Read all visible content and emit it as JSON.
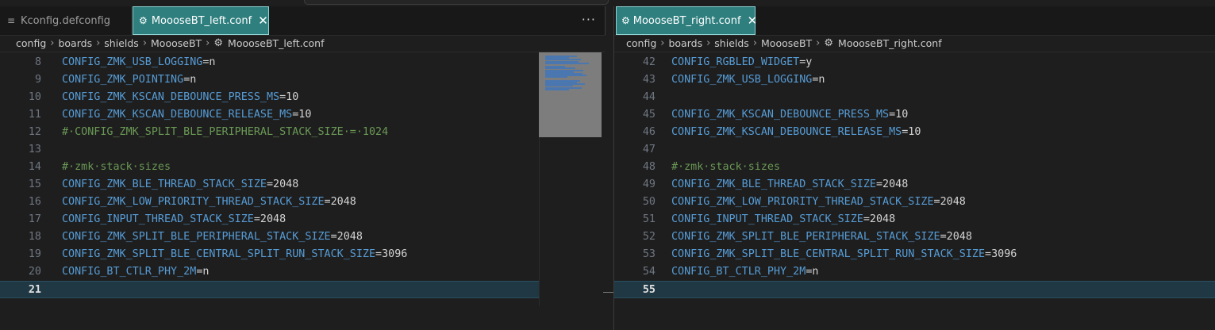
{
  "left": {
    "tabs": [
      {
        "label": "Kconfig.defconfig",
        "icon": "list-icon",
        "active": false
      },
      {
        "label": "MoooseBT_left.conf",
        "icon": "gear-icon",
        "active": true
      }
    ],
    "more_label": "···",
    "breadcrumb": [
      "config",
      "boards",
      "shields",
      "MoooseBT",
      "MoooseBT_left.conf"
    ],
    "current_line": "21",
    "lines": [
      {
        "n": "8",
        "key": "CONFIG_ZMK_USB_LOGGING",
        "val": "=n"
      },
      {
        "n": "9",
        "key": "CONFIG_ZMK_POINTING",
        "val": "=n"
      },
      {
        "n": "10",
        "key": "CONFIG_ZMK_KSCAN_DEBOUNCE_PRESS_MS",
        "val": "=10"
      },
      {
        "n": "11",
        "key": "CONFIG_ZMK_KSCAN_DEBOUNCE_RELEASE_MS",
        "val": "=10"
      },
      {
        "n": "12",
        "comment": "#·CONFIG_ZMK_SPLIT_BLE_PERIPHERAL_STACK_SIZE·=·1024"
      },
      {
        "n": "13"
      },
      {
        "n": "14",
        "comment": "#·zmk·stack·sizes"
      },
      {
        "n": "15",
        "key": "CONFIG_ZMK_BLE_THREAD_STACK_SIZE",
        "val": "=2048"
      },
      {
        "n": "16",
        "key": "CONFIG_ZMK_LOW_PRIORITY_THREAD_STACK_SIZE",
        "val": "=2048"
      },
      {
        "n": "17",
        "key": "CONFIG_INPUT_THREAD_STACK_SIZE",
        "val": "=2048"
      },
      {
        "n": "18",
        "key": "CONFIG_ZMK_SPLIT_BLE_PERIPHERAL_STACK_SIZE",
        "val": "=2048"
      },
      {
        "n": "19",
        "key": "CONFIG_ZMK_SPLIT_BLE_CENTRAL_SPLIT_RUN_STACK_SIZE",
        "val": "=3096"
      },
      {
        "n": "20",
        "key": "CONFIG_BT_CTLR_PHY_2M",
        "val": "=n"
      },
      {
        "n": "21",
        "current": true
      }
    ]
  },
  "right": {
    "tabs": [
      {
        "label": "MoooseBT_right.conf",
        "icon": "gear-icon",
        "active": true
      }
    ],
    "breadcrumb": [
      "config",
      "boards",
      "shields",
      "MoooseBT",
      "MoooseBT_right.conf"
    ],
    "lines": [
      {
        "n": "42",
        "key": "CONFIG_RGBLED_WIDGET",
        "val": "=y"
      },
      {
        "n": "43",
        "key": "CONFIG_ZMK_USB_LOGGING",
        "val": "=n"
      },
      {
        "n": "44"
      },
      {
        "n": "45",
        "key": "CONFIG_ZMK_KSCAN_DEBOUNCE_PRESS_MS",
        "val": "=10"
      },
      {
        "n": "46",
        "key": "CONFIG_ZMK_KSCAN_DEBOUNCE_RELEASE_MS",
        "val": "=10"
      },
      {
        "n": "47"
      },
      {
        "n": "48",
        "comment": "#·zmk·stack·sizes"
      },
      {
        "n": "49",
        "key": "CONFIG_ZMK_BLE_THREAD_STACK_SIZE",
        "val": "=2048"
      },
      {
        "n": "50",
        "key": "CONFIG_ZMK_LOW_PRIORITY_THREAD_STACK_SIZE",
        "val": "=2048"
      },
      {
        "n": "51",
        "key": "CONFIG_INPUT_THREAD_STACK_SIZE",
        "val": "=2048"
      },
      {
        "n": "52",
        "key": "CONFIG_ZMK_SPLIT_BLE_PERIPHERAL_STACK_SIZE",
        "val": "=2048"
      },
      {
        "n": "53",
        "key": "CONFIG_ZMK_SPLIT_BLE_CENTRAL_SPLIT_RUN_STACK_SIZE",
        "val": "=3096"
      },
      {
        "n": "54",
        "key": "CONFIG_BT_CTLR_PHY_2M",
        "val": "=n"
      },
      {
        "n": "55",
        "current": true
      }
    ]
  },
  "colors": {
    "keyword": "#569cd6",
    "comment": "#6a9955",
    "value": "#d4d4d4",
    "active_tab": "#2f7f7f"
  }
}
